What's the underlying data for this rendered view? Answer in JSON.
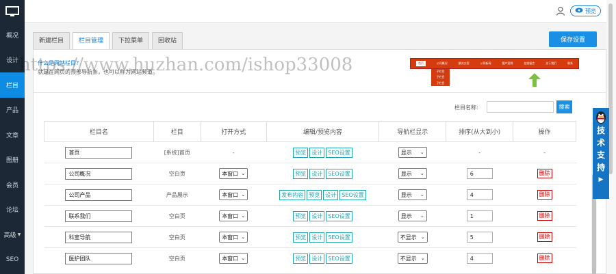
{
  "sidebar": {
    "items": [
      {
        "label": "概况"
      },
      {
        "label": "设计"
      },
      {
        "label": "栏目"
      },
      {
        "label": "产品"
      },
      {
        "label": "文章"
      },
      {
        "label": "图册"
      },
      {
        "label": "会员"
      },
      {
        "label": "论坛"
      },
      {
        "label": "高级"
      },
      {
        "label": "SEO"
      }
    ]
  },
  "header": {
    "preview_label": "预览"
  },
  "tabs": [
    {
      "label": "新建栏目"
    },
    {
      "label": "栏目管理"
    },
    {
      "label": "下拉菜单"
    },
    {
      "label": "回收站"
    }
  ],
  "save_label": "保存设置",
  "info": {
    "question": "什么是网站栏目?",
    "desc": "就是在网页的顶部导航条，也可以称为网站频道。"
  },
  "nav_demo": {
    "items": [
      "首页",
      "公司概况",
      "解决方案",
      "公司新闻",
      "客户案例",
      "在线留言",
      "关于我们",
      "联系"
    ],
    "sub_items": [
      "子栏目",
      "子栏目",
      "子栏目"
    ]
  },
  "search": {
    "label": "栏目名称:",
    "button": "搜索"
  },
  "table": {
    "headers": [
      "栏目名",
      "栏目",
      "打开方式",
      "编辑/预览内容",
      "导航栏显示",
      "排序(从大到小)",
      "操作"
    ],
    "rows": [
      {
        "name": "首页",
        "type": "[系统]首页",
        "open": "-",
        "actions": [
          "预览",
          "设计",
          "SEO设置"
        ],
        "nav": "显示",
        "sort": "-",
        "op": "-"
      },
      {
        "name": "公司概况",
        "type": "空白页",
        "open": "本窗口",
        "actions": [
          "预览",
          "设计",
          "SEO设置"
        ],
        "nav": "显示",
        "sort": "6",
        "op": "删除"
      },
      {
        "name": "公司产品",
        "type": "产品展示",
        "open": "本窗口",
        "actions": [
          "发布内容",
          "预览",
          "设计",
          "SEO设置"
        ],
        "nav": "显示",
        "sort": "4",
        "op": "删除"
      },
      {
        "name": "联系我们",
        "type": "空白页",
        "open": "本窗口",
        "actions": [
          "预览",
          "设计",
          "SEO设置"
        ],
        "nav": "显示",
        "sort": "1",
        "op": "删除"
      },
      {
        "name": "科室导航",
        "type": "空白页",
        "open": "本窗口",
        "actions": [
          "预览",
          "设计",
          "SEO设置"
        ],
        "nav": "不显示",
        "sort": "5",
        "op": "删除"
      },
      {
        "name": "医护团队",
        "type": "空白页",
        "open": "本窗口",
        "actions": [
          "预览",
          "设计",
          "SEO设置"
        ],
        "nav": "不显示",
        "sort": "4",
        "op": "删除"
      }
    ]
  },
  "support": {
    "chars": [
      "技",
      "术",
      "支",
      "持"
    ]
  },
  "watermark": "https://www.huzhan.com/ishop33008",
  "colors": {
    "sidebar_bg": "#1d2836",
    "accent": "#1a8fe3",
    "delete": "#cc0000",
    "edit_btn": "#1aa7b3",
    "nav_demo": "#d63b0e"
  }
}
